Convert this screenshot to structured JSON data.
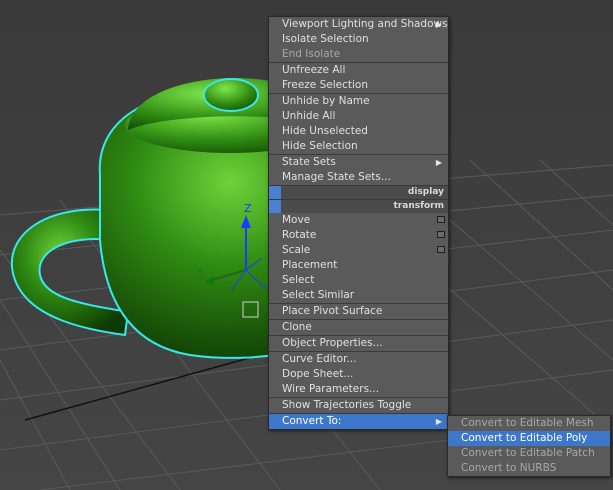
{
  "colors": {
    "teapot": "#2e7d10",
    "selection_outline": "#39e7ee",
    "menu_bg": "#5a5a5a",
    "highlight": "#3c77c9"
  },
  "gizmo": {
    "z_label": "Z",
    "y_label": "Y"
  },
  "quad_menu": {
    "items": [
      {
        "label": "Viewport Lighting and Shadows",
        "disabled": false,
        "submenu": true
      },
      {
        "label": "Isolate Selection",
        "disabled": false
      },
      {
        "label": "End Isolate",
        "disabled": true
      },
      {
        "label": "Unfreeze All",
        "disabled": false
      },
      {
        "label": "Freeze Selection",
        "disabled": false
      },
      {
        "label": "Unhide by Name",
        "disabled": false
      },
      {
        "label": "Unhide All",
        "disabled": false
      },
      {
        "label": "Hide Unselected",
        "disabled": false
      },
      {
        "label": "Hide Selection",
        "disabled": false
      },
      {
        "label": "State Sets",
        "disabled": false,
        "submenu": true
      },
      {
        "label": "Manage State Sets...",
        "disabled": false
      }
    ],
    "display_header": "display",
    "transform_header": "transform",
    "transform_items": [
      {
        "label": "Move",
        "disabled": false,
        "options_box": true
      },
      {
        "label": "Rotate",
        "disabled": false,
        "options_box": true
      },
      {
        "label": "Scale",
        "disabled": false,
        "options_box": true
      },
      {
        "label": "Placement",
        "disabled": false
      },
      {
        "label": "Select",
        "disabled": false
      },
      {
        "label": "Select Similar",
        "disabled": false
      },
      {
        "label": "Place Pivot Surface",
        "disabled": false
      },
      {
        "label": "Clone",
        "disabled": false
      },
      {
        "label": "Object Properties...",
        "disabled": false
      },
      {
        "label": "Curve Editor...",
        "disabled": false
      },
      {
        "label": "Dope Sheet...",
        "disabled": false
      },
      {
        "label": "Wire Parameters...",
        "disabled": false
      },
      {
        "label": "Show Trajectories Toggle",
        "disabled": false
      },
      {
        "label": "Convert To:",
        "disabled": false,
        "submenu": true,
        "highlighted": true
      }
    ]
  },
  "convert_submenu": {
    "items": [
      {
        "label": "Convert to Editable Mesh",
        "active": false
      },
      {
        "label": "Convert to Editable Poly",
        "active": true
      },
      {
        "label": "Convert to Editable Patch",
        "active": false
      },
      {
        "label": "Convert to NURBS",
        "active": false
      }
    ]
  }
}
